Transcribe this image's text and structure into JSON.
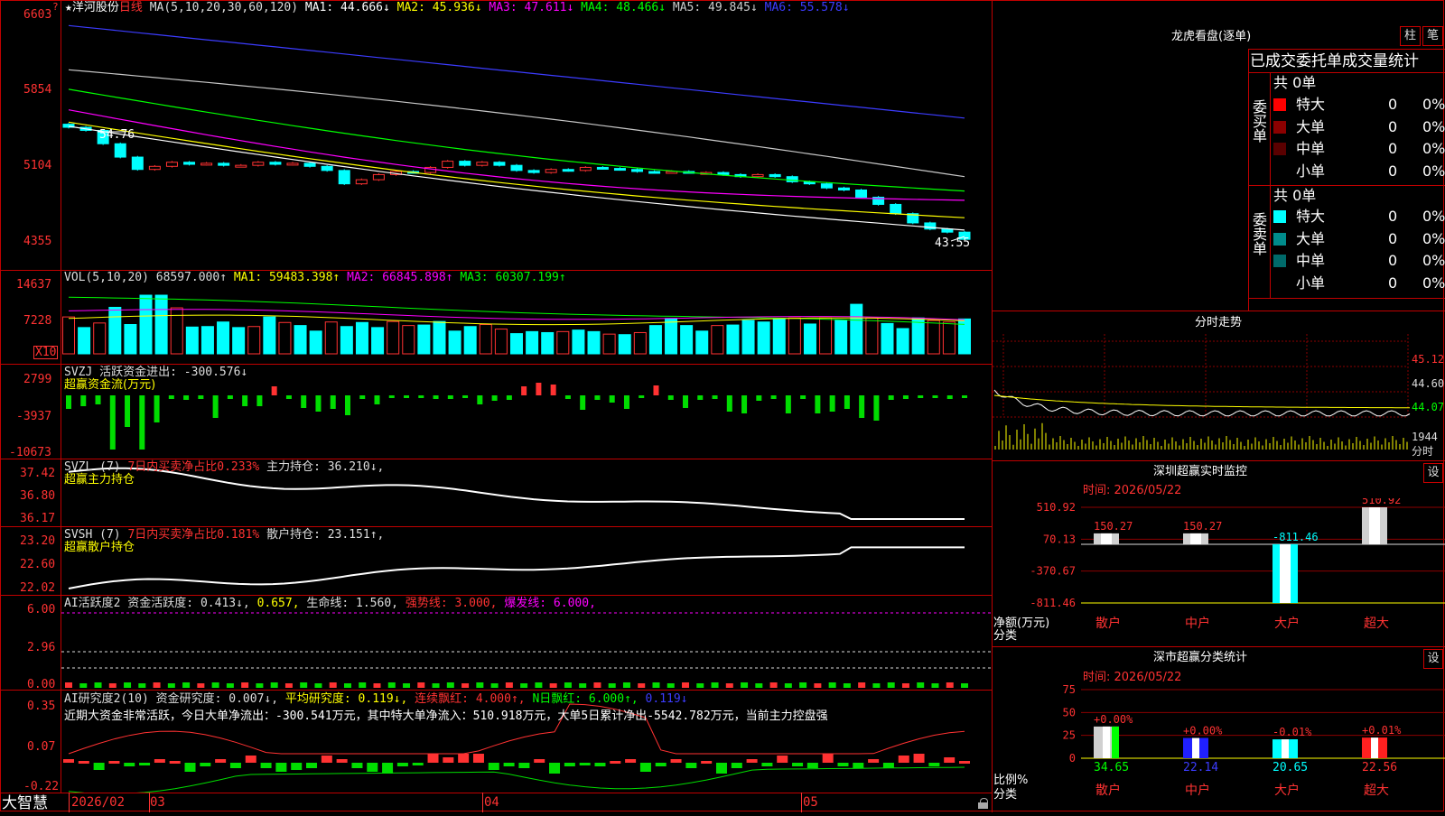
{
  "app": {
    "name": "大智慧",
    "lock_icon": "lock-icon"
  },
  "stock": {
    "star": "★",
    "name": "洋河股份",
    "period": "日线"
  },
  "colors": {
    "red": "#ff3232",
    "cyan": "#00ffff",
    "white": "#ffffff",
    "yellow": "#ffff00",
    "magenta": "#ff00ff",
    "green": "#00ff00",
    "blue": "#2a2aff",
    "gray": "#c8c8c8",
    "frame": "#c00000"
  },
  "main": {
    "legend": [
      {
        "text": "MA(5,10,20,30,60,120)",
        "color": "#dddddd"
      },
      {
        "text": "MA1: 44.666↓",
        "color": "#ffffff"
      },
      {
        "text": "MA2: 45.936↓",
        "color": "#ffff00"
      },
      {
        "text": "MA3: 47.611↓",
        "color": "#ff00ff"
      },
      {
        "text": "MA4: 48.466↓",
        "color": "#00ff00"
      },
      {
        "text": "MA5: 49.845↓",
        "color": "#cccccc"
      },
      {
        "text": "MA6: 55.578↓",
        "color": "#3c3cff"
      }
    ],
    "y_ticks": [
      "6603",
      "5854",
      "5104",
      "4355"
    ],
    "annotation_high": "54.76",
    "annotation_low": "43.55"
  },
  "vol": {
    "legend": [
      {
        "text": "VOL(5,10,20)",
        "color": "#dddddd"
      },
      {
        "text": "68597.000↑",
        "color": "#dddddd"
      },
      {
        "text": "MA1: 59483.398↑",
        "color": "#ffff00"
      },
      {
        "text": "MA2: 66845.898↑",
        "color": "#ff00ff"
      },
      {
        "text": "MA3: 60307.199↑",
        "color": "#00ff00"
      }
    ],
    "y_ticks": [
      "14637",
      "7228"
    ],
    "unit": "X10"
  },
  "svzj": {
    "legend": [
      {
        "text": "SVZJ  活跃资金进出: -300.576↓",
        "color": "#dddddd"
      }
    ],
    "subtitle": "超赢资金流(万元)",
    "y_ticks": [
      "2799",
      "-3937",
      "-10673"
    ]
  },
  "svzl": {
    "legend": [
      {
        "text": "SVZL (7)",
        "color": "#dddddd"
      },
      {
        "text": "7日内买卖净占比0.233%",
        "color": "#ff3232"
      },
      {
        "text": "主力持仓: 36.210↓,",
        "color": "#dddddd"
      }
    ],
    "subtitle": "超赢主力持仓",
    "y_ticks": [
      "37.42",
      "36.80",
      "36.17"
    ]
  },
  "svsh": {
    "legend": [
      {
        "text": "SVSH (7)",
        "color": "#dddddd"
      },
      {
        "text": "7日内买卖净占比0.181%",
        "color": "#ff3232"
      },
      {
        "text": "散户持仓: 23.151↑,",
        "color": "#dddddd"
      }
    ],
    "subtitle": "超赢散户持仓",
    "y_ticks": [
      "23.20",
      "22.60",
      "22.02"
    ]
  },
  "ai_active": {
    "legend": [
      {
        "text": "AI活跃度2 资金活跃度: 0.413↓,",
        "color": "#dddddd"
      },
      {
        "text": "0.657,",
        "color": "#ffff00"
      },
      {
        "text": "生命线: 1.560,",
        "color": "#dddddd"
      },
      {
        "text": "强势线: 3.000,",
        "color": "#ff3232"
      },
      {
        "text": "爆发线: 6.000,",
        "color": "#ff00ff"
      }
    ],
    "y_ticks": [
      "6.00",
      "2.96",
      "0.00"
    ]
  },
  "ai_research": {
    "legend": [
      {
        "text": "AI研究度2(10) 资金研究度: 0.007↓,",
        "color": "#dddddd"
      },
      {
        "text": "平均研究度: 0.119↓,",
        "color": "#ffff00"
      },
      {
        "text": "连续飘红: 4.000↑,",
        "color": "#ff3232"
      },
      {
        "text": "N日飘红: 6.000↑,",
        "color": "#00ff00"
      },
      {
        "text": "0.119↓",
        "color": "#3c3cff"
      }
    ],
    "summary": "近期大资金非常活跃，今日大单净流出：-300.541万元，其中特大单净流入：510.918万元，大单5日累计净出-5542.782万元，当前主力控盘强",
    "y_ticks": [
      "0.35",
      "0.07",
      "-0.22"
    ]
  },
  "date_axis": [
    "2026/02",
    "03",
    "04",
    "05"
  ],
  "right": {
    "dragon_title": "龙虎看盘(逐单)",
    "btn_bar": "柱",
    "btn_pen": "笔",
    "tabs": [
      "已成交",
      "委托单",
      "成交量统计"
    ],
    "buy_label": "委买单",
    "sell_label": "委卖单",
    "buy_total": "共 0单",
    "sell_total": "共 0单",
    "buy_rows": [
      {
        "name": "特大",
        "count": "0",
        "pct": "0%",
        "color": "#ff0000"
      },
      {
        "name": "大单",
        "count": "0",
        "pct": "0%",
        "color": "#8b0000"
      },
      {
        "name": "中单",
        "count": "0",
        "pct": "0%",
        "color": "#5a0000"
      },
      {
        "name": "小单",
        "count": "0",
        "pct": "0%",
        "color": ""
      }
    ],
    "sell_rows": [
      {
        "name": "特大",
        "count": "0",
        "pct": "0%",
        "color": "#00ffff"
      },
      {
        "name": "大单",
        "count": "0",
        "pct": "0%",
        "color": "#008b8b"
      },
      {
        "name": "中单",
        "count": "0",
        "pct": "0%",
        "color": "#006a6a"
      },
      {
        "name": "小单",
        "count": "0",
        "pct": "0%",
        "color": ""
      }
    ],
    "intraday_title": "分时走势",
    "intraday_ticks": [
      "45.12",
      "44.60",
      "44.07",
      "1944",
      "分时"
    ],
    "monitor_title": "深圳超赢实时监控",
    "monitor_btn": "设",
    "monitor_time": "时间: 2026/05/22",
    "monitor_ylabel": "净额(万元)",
    "monitor_xlabel": "分类",
    "classify_title": "深市超赢分类统计",
    "classify_btn": "设",
    "classify_time": "时间: 2026/05/22",
    "classify_ylabel": "比例%",
    "classify_xlabel": "分类"
  },
  "chart_data": [
    {
      "type": "candlestick",
      "title": "洋河股份 日线",
      "x": [
        "2026/02",
        "03",
        "04",
        "05"
      ],
      "ylim": [
        4355,
        6603
      ],
      "close_approx": [
        54.7,
        54.4,
        53.1,
        51.8,
        50.6,
        50.9,
        51.3,
        51.1,
        51.2,
        51.0,
        51.0,
        51.3,
        51.1,
        51.2,
        50.9,
        50.5,
        49.2,
        49.6,
        50.1,
        50.4,
        50.3,
        50.8,
        51.4,
        51.0,
        51.3,
        51.0,
        50.5,
        50.3,
        50.6,
        50.5,
        50.8,
        50.7,
        50.6,
        50.4,
        50.3,
        50.4,
        50.3,
        50.3,
        50.1,
        49.9,
        50.1,
        49.9,
        49.4,
        49.2,
        48.8,
        48.6,
        47.9,
        47.2,
        46.3,
        45.4,
        44.8,
        44.5,
        43.8
      ]
    },
    {
      "type": "bar",
      "title": "VOL",
      "ylim": [
        0,
        14637
      ],
      "values_approx": [
        7300,
        5200,
        6100,
        9200,
        5800,
        11600,
        11600,
        9100,
        5300,
        5400,
        6300,
        5200,
        5400,
        7300,
        6200,
        5600,
        4500,
        6300,
        5400,
        6200,
        5200,
        6400,
        5600,
        5700,
        6400,
        4500,
        5400,
        5800,
        4900,
        4000,
        4400,
        4200,
        4400,
        4700,
        4400,
        3900,
        3800,
        4200,
        5600,
        7000,
        5600,
        4500,
        5600,
        5700,
        6600,
        6300,
        6900,
        7100,
        5900,
        7100,
        6600,
        9800,
        7100,
        6000,
        5000,
        7100,
        6600,
        6300,
        6900
      ]
    },
    {
      "type": "bar",
      "title": "深圳超赢实时监控",
      "categories": [
        "散户",
        "中户",
        "大户",
        "超大"
      ],
      "values": [
        150.27,
        150.27,
        -811.46,
        510.92
      ],
      "ylim": [
        -811.46,
        510.92
      ],
      "yticks": [
        "510.92",
        "70.13",
        "-370.67",
        "-811.46"
      ]
    },
    {
      "type": "bar",
      "title": "深市超赢分类统计",
      "categories": [
        "散户",
        "中户",
        "大户",
        "超大"
      ],
      "values": [
        34.65,
        22.14,
        20.65,
        22.56
      ],
      "changes": [
        "+0.00%",
        "+0.00%",
        "-0.01%",
        "+0.01%"
      ],
      "ylim": [
        0,
        75
      ],
      "yticks": [
        "75",
        "50",
        "25",
        "0"
      ]
    }
  ]
}
